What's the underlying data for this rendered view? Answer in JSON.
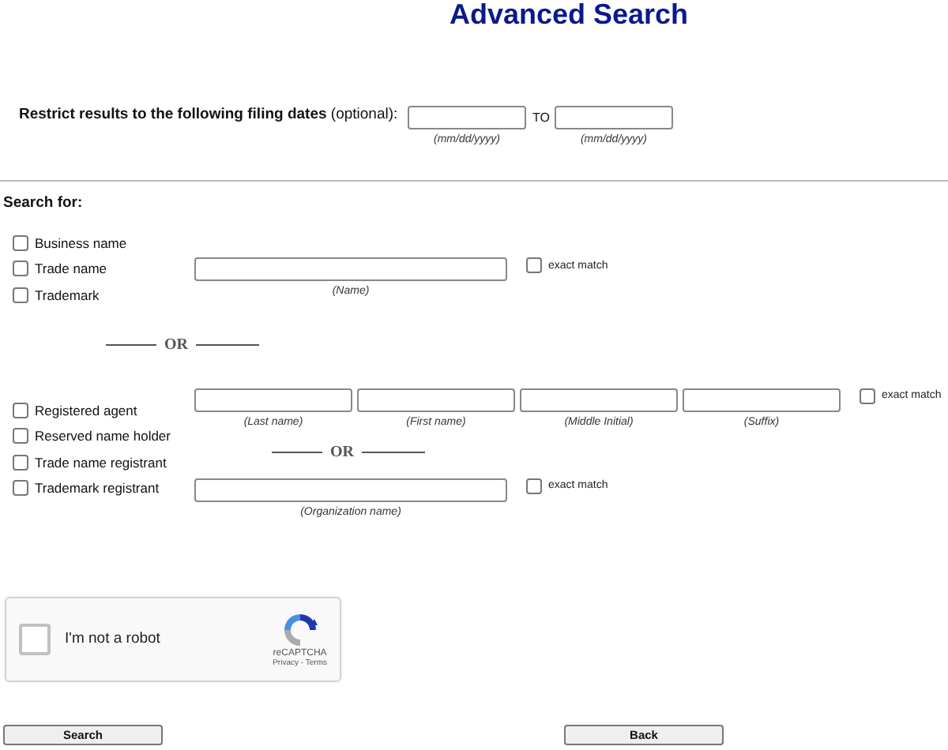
{
  "title": "Advanced Search",
  "date_filter": {
    "label": "**Restrict results to the following filing dates** (optional):",
    "from_hint": "(mm/dd/yyyy)",
    "to_label": "TO",
    "to_hint": "(mm/dd/yyyy)"
  },
  "search_for": "Search for:",
  "entity_types": [
    {
      "label": "Business name",
      "checked": false
    },
    {
      "label": "Trade name",
      "checked": false
    },
    {
      "label": "Trademark",
      "checked": false
    }
  ],
  "name_field": {
    "hint": "(Name)",
    "exact_match": {
      "label": "exact match",
      "checked": false
    }
  },
  "or_1": "OR",
  "person_types": [
    {
      "label": "Registered agent",
      "checked": false
    },
    {
      "label": "Reserved name holder",
      "checked": false
    },
    {
      "label": "Trade name registrant",
      "checked": false
    },
    {
      "label": "Trademark registrant",
      "checked": false
    }
  ],
  "person_fields": [
    {
      "hint": "(Last name)"
    },
    {
      "hint": "(First name)"
    },
    {
      "hint": "(Middle Initial)"
    },
    {
      "hint": "(Suffix)"
    }
  ],
  "person_exact": {
    "label": "exact match",
    "checked": false
  },
  "or_2": "OR",
  "org_field": {
    "hint": "(Organization name)",
    "exact_match": {
      "label": "exact match",
      "checked": false
    }
  },
  "captcha": {
    "label": "I'm not a robot",
    "checked": false,
    "brand": "reCAPTCHA",
    "privacy": "Privacy",
    "separator": "-",
    "terms": "Terms"
  },
  "buttons": [
    "Search",
    "Back"
  ]
}
